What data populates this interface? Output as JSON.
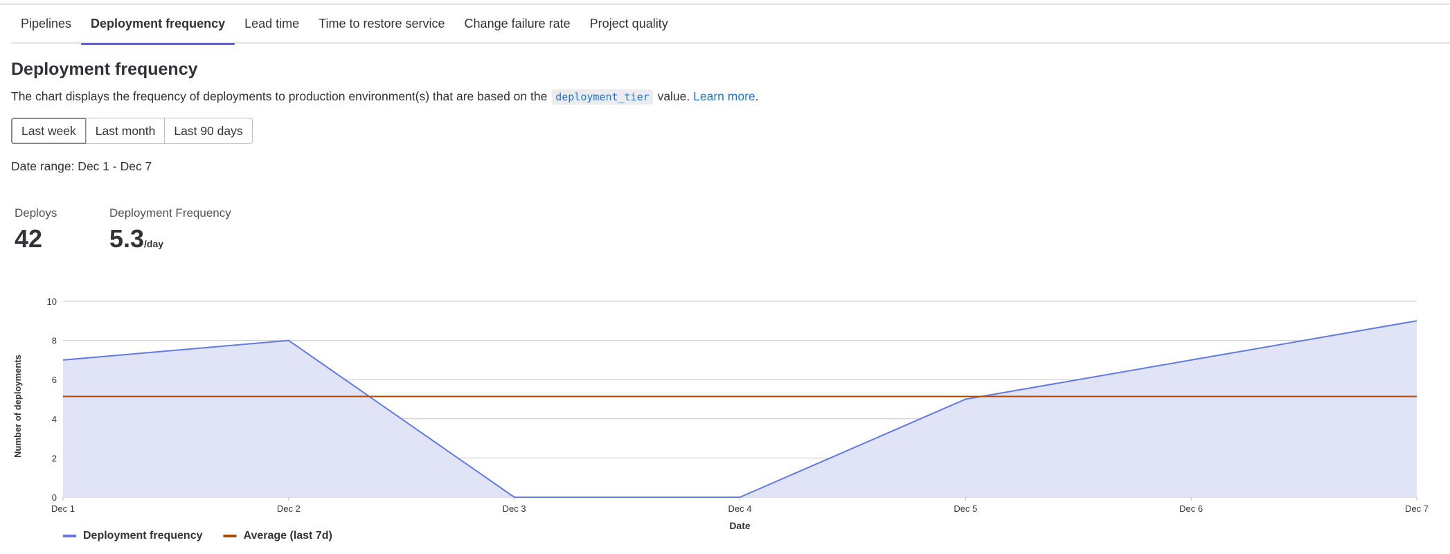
{
  "tabs": [
    {
      "label": "Pipelines"
    },
    {
      "label": "Deployment frequency"
    },
    {
      "label": "Lead time"
    },
    {
      "label": "Time to restore service"
    },
    {
      "label": "Change failure rate"
    },
    {
      "label": "Project quality"
    }
  ],
  "page": {
    "title": "Deployment frequency",
    "description_before": "The chart displays the frequency of deployments to production environment(s) that are based on the",
    "code_term": "deployment_tier",
    "description_after": "value.",
    "learn_more": "Learn more",
    "learn_more_period": "."
  },
  "filters": [
    {
      "label": "Last week",
      "selected": true
    },
    {
      "label": "Last month",
      "selected": false
    },
    {
      "label": "Last 90 days",
      "selected": false
    }
  ],
  "date_range": "Date range: Dec 1 - Dec 7",
  "stats": {
    "deploys": {
      "label": "Deploys",
      "value": "42"
    },
    "frequency": {
      "label": "Deployment Frequency",
      "value": "5.3",
      "unit": "/day"
    }
  },
  "chart_data": {
    "type": "area",
    "categories": [
      "Dec 1",
      "Dec 2",
      "Dec 3",
      "Dec 4",
      "Dec 5",
      "Dec 6",
      "Dec 7"
    ],
    "series": [
      {
        "name": "Deployment frequency",
        "values": [
          7,
          8,
          0,
          0,
          5,
          7,
          9
        ],
        "color": "#617ae2",
        "fill": "#e0e4f6"
      },
      {
        "name": "Average (last 7d)",
        "values": [
          5.14,
          5.14,
          5.14,
          5.14,
          5.14,
          5.14,
          5.14
        ],
        "color": "#b24800"
      }
    ],
    "xlabel": "Date",
    "ylabel": "Number of deployments",
    "ylim": [
      0,
      10
    ],
    "yticks": [
      0,
      2,
      4,
      6,
      8,
      10
    ],
    "grid": true,
    "legend_position": "bottom-left"
  }
}
